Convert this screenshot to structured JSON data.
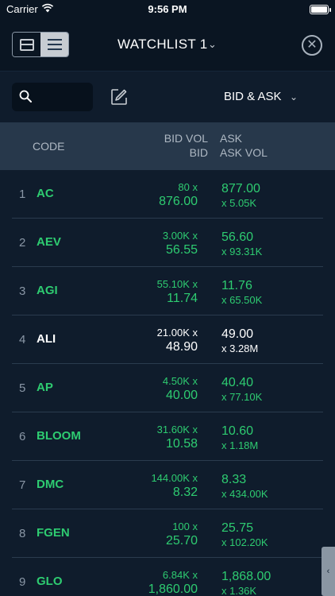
{
  "status_bar": {
    "carrier": "Carrier",
    "time": "9:56 PM"
  },
  "header": {
    "title": "WATCHLIST 1",
    "title_chevron": "⌄",
    "close_glyph": "✕"
  },
  "toolbar": {
    "search": {
      "placeholder": ""
    },
    "mode_label": "BID & ASK",
    "mode_chevron": "⌄"
  },
  "columns": {
    "code": "CODE",
    "bid_vol": "BID VOL",
    "bid": "BID",
    "ask": "ASK",
    "ask_vol": "ASK VOL"
  },
  "colors": {
    "up": "#2ecc71",
    "neutral": "#ffffff",
    "background": "#0f1c2c",
    "header_row": "#27384b"
  },
  "icons": {
    "grid_view": "card-view-icon",
    "list_view": "list-view-icon",
    "search": "search-icon",
    "edit": "edit-icon",
    "close": "close-circle-icon",
    "side_tab": "chevron-left-icon"
  },
  "side_tab": {
    "glyph": "‹"
  },
  "rows": [
    {
      "index": "1",
      "code": "AC",
      "bid_vol": "80 x",
      "bid": "876.00",
      "ask": "877.00",
      "ask_vol": "x 5.05K",
      "trend": "up"
    },
    {
      "index": "2",
      "code": "AEV",
      "bid_vol": "3.00K x",
      "bid": "56.55",
      "ask": "56.60",
      "ask_vol": "x 93.31K",
      "trend": "up"
    },
    {
      "index": "3",
      "code": "AGI",
      "bid_vol": "55.10K x",
      "bid": "11.74",
      "ask": "11.76",
      "ask_vol": "x 65.50K",
      "trend": "up"
    },
    {
      "index": "4",
      "code": "ALI",
      "bid_vol": "21.00K x",
      "bid": "48.90",
      "ask": "49.00",
      "ask_vol": "x 3.28M",
      "trend": "neutral"
    },
    {
      "index": "5",
      "code": "AP",
      "bid_vol": "4.50K x",
      "bid": "40.00",
      "ask": "40.40",
      "ask_vol": "x 77.10K",
      "trend": "up"
    },
    {
      "index": "6",
      "code": "BLOOM",
      "bid_vol": "31.60K x",
      "bid": "10.58",
      "ask": "10.60",
      "ask_vol": "x 1.18M",
      "trend": "up"
    },
    {
      "index": "7",
      "code": "DMC",
      "bid_vol": "144.00K x",
      "bid": "8.32",
      "ask": "8.33",
      "ask_vol": "x 434.00K",
      "trend": "up"
    },
    {
      "index": "8",
      "code": "FGEN",
      "bid_vol": "100 x",
      "bid": "25.70",
      "ask": "25.75",
      "ask_vol": "x 102.20K",
      "trend": "up"
    },
    {
      "index": "9",
      "code": "GLO",
      "bid_vol": "6.84K x",
      "bid": "1,860.00",
      "ask": "1,868.00",
      "ask_vol": "x 1.36K",
      "trend": "up"
    }
  ]
}
